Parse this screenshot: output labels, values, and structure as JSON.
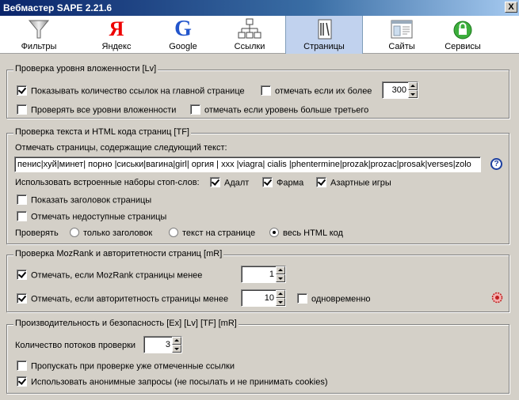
{
  "window": {
    "title": "Вебмастер SAPE 2.21.6",
    "close_label": "X"
  },
  "toolbar": [
    {
      "label": "Фильтры",
      "icon": "funnel-icon"
    },
    {
      "label": "Яндекс",
      "icon": "yandex-logo-icon",
      "glyph": "Я"
    },
    {
      "label": "Google",
      "icon": "google-logo-icon",
      "glyph": "G"
    },
    {
      "label": "Ссылки",
      "icon": "sitemap-icon"
    },
    {
      "label": "Страницы",
      "icon": "pages-icon",
      "active": true
    },
    {
      "label": "Сайты",
      "icon": "sites-icon"
    },
    {
      "label": "Сервисы",
      "icon": "services-icon"
    }
  ],
  "colors": {
    "active_tab": "#c1d2ee",
    "title_gradient_start": "#0a246a",
    "panel_bg": "#d4d0c8"
  },
  "group_lv": {
    "legend": "Проверка уровня вложенности [Lv]",
    "show_count_label": "Показывать количество ссылок на главной странице",
    "show_count_checked": true,
    "mark_if_more_label": "отмечать если их более",
    "mark_if_more_checked": false,
    "mark_if_more_value": "300",
    "check_all_levels_label": "Проверять все уровни вложенности",
    "check_all_levels_checked": false,
    "mark_level_third_label": "отмечать если уровень больше третьего",
    "mark_level_third_checked": false
  },
  "group_tf": {
    "legend": "Проверка текста и HTML кода страниц [TF]",
    "mark_pages_label": "Отмечать страницы, содержащие следующий текст:",
    "filter_text": "пенис|хуй|минет| порно |сиськи|вагина|girl| оргия | xxx |viagra| cialis |phentermine|prozak|prozac|prosak|verses|zolo",
    "help_glyph": "?",
    "stopwords_label": "Использовать встроенные наборы стоп-слов:",
    "stop_adult_label": "Адалт",
    "stop_adult_checked": true,
    "stop_pharma_label": "Фарма",
    "stop_pharma_checked": true,
    "stop_gambling_label": "Азартные игры",
    "stop_gambling_checked": true,
    "show_title_label": "Показать заголовок страницы",
    "show_title_checked": false,
    "mark_unavailable_label": "Отмечать недоступные страницы",
    "mark_unavailable_checked": false,
    "check_label": "Проверять",
    "radio_title_only": "только заголовок",
    "radio_page_text": "текст на странице",
    "radio_full_html": "весь HTML код",
    "radio_selected": "full_html"
  },
  "group_mr": {
    "legend": "Проверка MozRank и авторитетности страниц [mR]",
    "mozrank_label": "Отмечать, если MozRank страницы менее",
    "mozrank_checked": true,
    "mozrank_value": "1",
    "authority_label": "Отмечать, если авторитетность страницы менее",
    "authority_checked": true,
    "authority_value": "10",
    "simultaneous_label": "одновременно",
    "simultaneous_checked": false
  },
  "group_perf": {
    "legend": "Производительность и безопасность [Ex] [Lv] [TF] [mR]",
    "threads_label": "Количество потоков проверки",
    "threads_value": "3",
    "skip_marked_label": "Пропускать при проверке уже отмеченные ссылки",
    "skip_marked_checked": false,
    "anonymous_label": "Использовать анонимные запросы (не посылать и не принимать cookies)",
    "anonymous_checked": true
  }
}
